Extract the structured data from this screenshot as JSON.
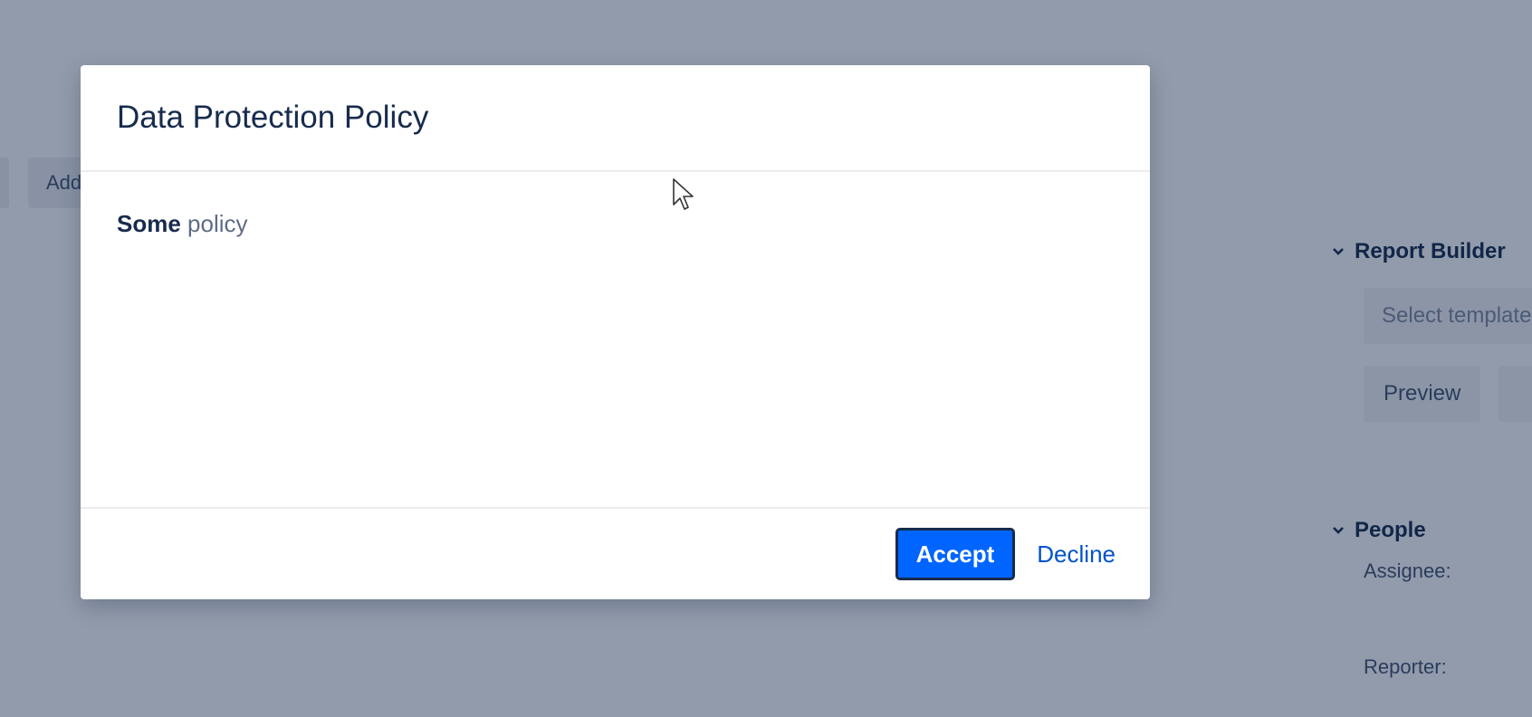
{
  "background": {
    "add_button_label": "Add",
    "report_builder": {
      "title": "Report Builder",
      "select_placeholder": "Select template",
      "preview_label": "Preview"
    },
    "people": {
      "title": "People",
      "assignee_label": "Assignee:",
      "reporter_label": "Reporter:"
    }
  },
  "modal": {
    "title": "Data Protection Policy",
    "body_bold": "Some",
    "body_text": " policy",
    "accept_label": "Accept",
    "decline_label": "Decline"
  },
  "colors": {
    "primary": "#0065ff",
    "link": "#0052cc",
    "overlay": "#091e42"
  }
}
